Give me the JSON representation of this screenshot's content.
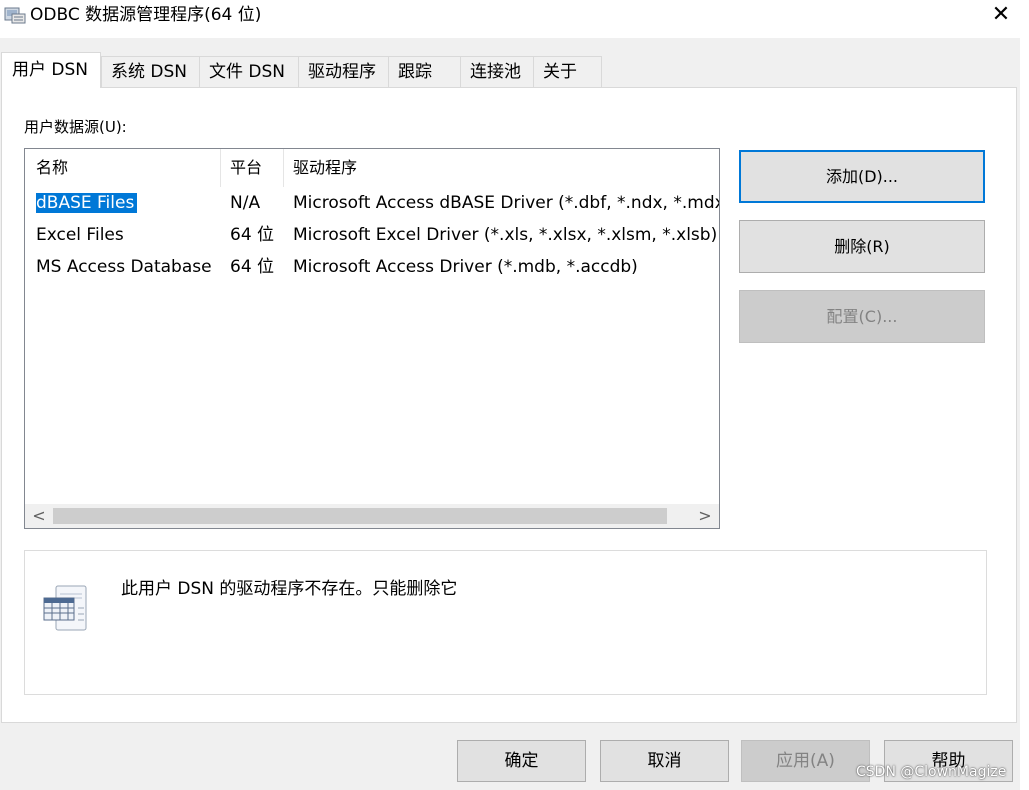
{
  "window": {
    "title": "ODBC 数据源管理程序(64 位)",
    "close_glyph": "✕"
  },
  "tabs": [
    {
      "label": "用户 DSN",
      "active": true
    },
    {
      "label": "系统 DSN"
    },
    {
      "label": "文件 DSN"
    },
    {
      "label": "驱动程序"
    },
    {
      "label": "跟踪"
    },
    {
      "label": "连接池"
    },
    {
      "label": "关于"
    }
  ],
  "user_dsn": {
    "label": "用户数据源(U):",
    "columns": [
      "名称",
      "平台",
      "驱动程序"
    ],
    "rows": [
      {
        "name": "dBASE Files",
        "platform": "N/A",
        "driver": "Microsoft Access dBASE Driver (*.dbf, *.ndx, *.mdx)",
        "selected": true
      },
      {
        "name": "Excel Files",
        "platform": "64 位",
        "driver": "Microsoft Excel Driver (*.xls, *.xlsx, *.xlsm, *.xlsb)"
      },
      {
        "name": "MS Access Database",
        "platform": "64 位",
        "driver": "Microsoft Access Driver (*.mdb, *.accdb)"
      }
    ],
    "scroll_left": "<",
    "scroll_right": ">"
  },
  "side_buttons": {
    "add": "添加(D)...",
    "remove": "删除(R)",
    "configure": "配置(C)..."
  },
  "info": {
    "message": "此用户 DSN 的驱动程序不存在。只能删除它",
    "icon": "data-source-icon"
  },
  "footer": {
    "ok": "确定",
    "cancel": "取消",
    "apply": "应用(A)",
    "help": "帮助"
  },
  "watermark": "CSDN @ClownMagize",
  "colors": {
    "selection": "#0078d7",
    "default_button_border": "#0078d7",
    "disabled_text": "#838383"
  }
}
